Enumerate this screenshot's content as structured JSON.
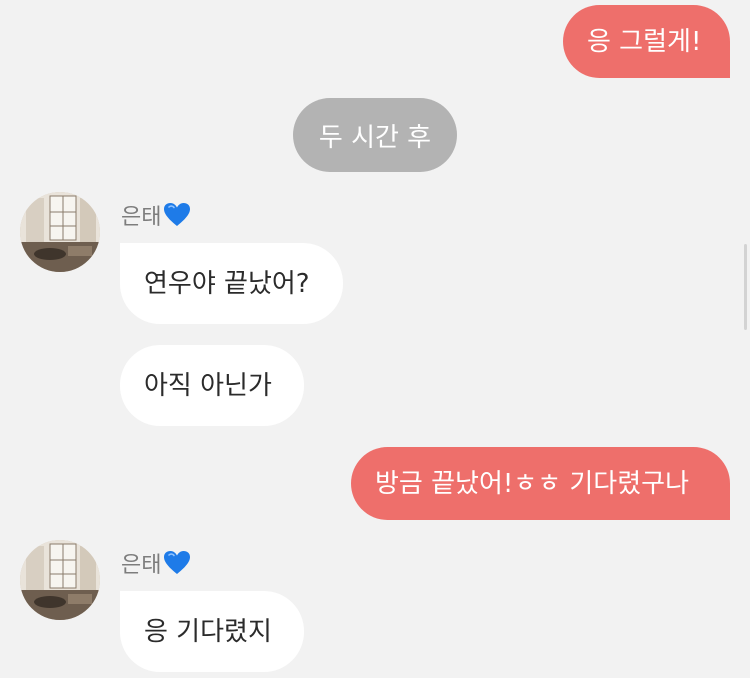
{
  "messages": {
    "m1": "응 그럴게!",
    "time_divider": "두 시간 후",
    "sender1": "은태",
    "m2": "연우야 끝났어?",
    "m3": "아직 아닌가",
    "m4": "방금 끝났어!ㅎㅎ 기다렸구나",
    "sender2": "은태",
    "m5": "응 기다렸지"
  },
  "colors": {
    "outgoing_bubble": "#ee6f6b",
    "incoming_bubble": "#ffffff",
    "time_pill": "#b3b3b3",
    "background": "#f2f2f2",
    "heart": "#1e7be8"
  },
  "icons": {
    "sender_badge": "blue-heart-icon",
    "avatar": "avatar-window-photo"
  }
}
